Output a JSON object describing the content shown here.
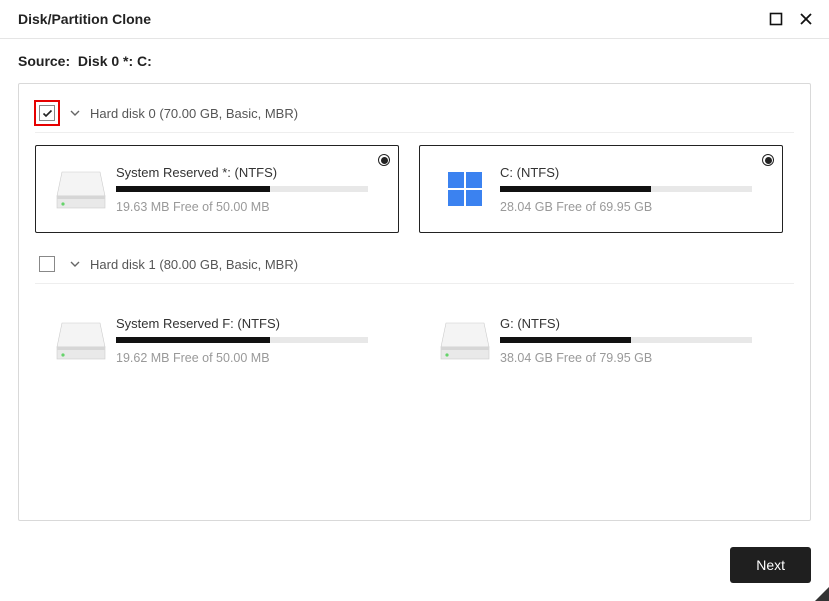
{
  "window": {
    "title": "Disk/Partition Clone"
  },
  "source": {
    "label": "Source:",
    "value": "Disk 0 *: C:"
  },
  "disks": [
    {
      "checked": true,
      "highlighted": true,
      "label": "Hard disk 0 (70.00 GB, Basic, MBR)",
      "partitions": [
        {
          "name": "System Reserved *: (NTFS)",
          "free": "19.63 MB Free of 50.00 MB",
          "fill_pct": 61,
          "icon": "disk",
          "selected": true,
          "bordered": true
        },
        {
          "name": "C: (NTFS)",
          "free": "28.04 GB Free of 69.95 GB",
          "fill_pct": 60,
          "icon": "windows",
          "selected": true,
          "bordered": true
        }
      ]
    },
    {
      "checked": false,
      "highlighted": false,
      "label": "Hard disk 1 (80.00 GB, Basic, MBR)",
      "partitions": [
        {
          "name": "System Reserved F: (NTFS)",
          "free": "19.62 MB Free of 50.00 MB",
          "fill_pct": 61,
          "icon": "disk",
          "selected": false,
          "bordered": false
        },
        {
          "name": "G: (NTFS)",
          "free": "38.04 GB Free of 79.95 GB",
          "fill_pct": 52,
          "icon": "disk",
          "selected": false,
          "bordered": false
        }
      ]
    }
  ],
  "buttons": {
    "next": "Next"
  }
}
